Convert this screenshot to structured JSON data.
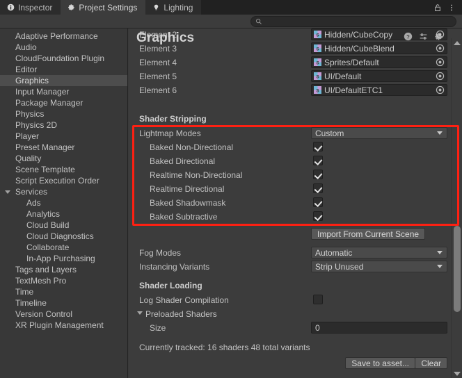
{
  "window": {
    "tabs": [
      {
        "label": "Inspector",
        "icon": "info-icon",
        "active": false
      },
      {
        "label": "Project Settings",
        "icon": "gear-icon",
        "active": true
      },
      {
        "label": "Lighting",
        "icon": "lightbulb-icon",
        "active": false
      }
    ],
    "lock_icon": "lock-icon",
    "menu_icon": "kebab-menu-icon"
  },
  "search": {
    "value": "",
    "placeholder": "",
    "icon": "search-icon"
  },
  "sidebar": {
    "items": [
      {
        "label": "Adaptive Performance",
        "depth": 0,
        "selected": false,
        "triangle": "none"
      },
      {
        "label": "Audio",
        "depth": 0,
        "selected": false,
        "triangle": "none"
      },
      {
        "label": "CloudFoundation Plugin",
        "depth": 0,
        "selected": false,
        "triangle": "none"
      },
      {
        "label": "Editor",
        "depth": 0,
        "selected": false,
        "triangle": "none"
      },
      {
        "label": "Graphics",
        "depth": 0,
        "selected": true,
        "triangle": "none"
      },
      {
        "label": "Input Manager",
        "depth": 0,
        "selected": false,
        "triangle": "none"
      },
      {
        "label": "Package Manager",
        "depth": 0,
        "selected": false,
        "triangle": "none"
      },
      {
        "label": "Physics",
        "depth": 0,
        "selected": false,
        "triangle": "none"
      },
      {
        "label": "Physics 2D",
        "depth": 0,
        "selected": false,
        "triangle": "none"
      },
      {
        "label": "Player",
        "depth": 0,
        "selected": false,
        "triangle": "none"
      },
      {
        "label": "Preset Manager",
        "depth": 0,
        "selected": false,
        "triangle": "none"
      },
      {
        "label": "Quality",
        "depth": 0,
        "selected": false,
        "triangle": "none"
      },
      {
        "label": "Scene Template",
        "depth": 0,
        "selected": false,
        "triangle": "none"
      },
      {
        "label": "Script Execution Order",
        "depth": 0,
        "selected": false,
        "triangle": "none"
      },
      {
        "label": "Services",
        "depth": 0,
        "selected": false,
        "triangle": "open"
      },
      {
        "label": "Ads",
        "depth": 1,
        "selected": false,
        "triangle": "none"
      },
      {
        "label": "Analytics",
        "depth": 1,
        "selected": false,
        "triangle": "none"
      },
      {
        "label": "Cloud Build",
        "depth": 1,
        "selected": false,
        "triangle": "none"
      },
      {
        "label": "Cloud Diagnostics",
        "depth": 1,
        "selected": false,
        "triangle": "none"
      },
      {
        "label": "Collaborate",
        "depth": 1,
        "selected": false,
        "triangle": "none"
      },
      {
        "label": "In-App Purchasing",
        "depth": 1,
        "selected": false,
        "triangle": "none"
      },
      {
        "label": "Tags and Layers",
        "depth": 0,
        "selected": false,
        "triangle": "none"
      },
      {
        "label": "TextMesh Pro",
        "depth": 0,
        "selected": false,
        "triangle": "none"
      },
      {
        "label": "Time",
        "depth": 0,
        "selected": false,
        "triangle": "none"
      },
      {
        "label": "Timeline",
        "depth": 0,
        "selected": false,
        "triangle": "none"
      },
      {
        "label": "Version Control",
        "depth": 0,
        "selected": false,
        "triangle": "none"
      },
      {
        "label": "XR Plugin Management",
        "depth": 0,
        "selected": false,
        "triangle": "none"
      }
    ]
  },
  "main": {
    "title": "Graphics",
    "title_icons": [
      "help-icon",
      "preset-icon",
      "gear-icon"
    ],
    "always_included_shaders": [
      {
        "label": "Element 2",
        "value": "Hidden/CubeCopy"
      },
      {
        "label": "Element 3",
        "value": "Hidden/CubeBlend"
      },
      {
        "label": "Element 4",
        "value": "Sprites/Default"
      },
      {
        "label": "Element 5",
        "value": "UI/Default"
      },
      {
        "label": "Element 6",
        "value": "UI/DefaultETC1"
      }
    ],
    "shader_stripping": {
      "heading": "Shader Stripping",
      "lightmap_modes": {
        "label": "Lightmap Modes",
        "value": "Custom"
      },
      "modes": [
        {
          "label": "Baked Non-Directional",
          "checked": true
        },
        {
          "label": "Baked Directional",
          "checked": true
        },
        {
          "label": "Realtime Non-Directional",
          "checked": true
        },
        {
          "label": "Realtime Directional",
          "checked": true
        },
        {
          "label": "Baked Shadowmask",
          "checked": true
        },
        {
          "label": "Baked Subtractive",
          "checked": true
        }
      ],
      "import_button": "Import From Current Scene",
      "fog_modes": {
        "label": "Fog Modes",
        "value": "Automatic"
      },
      "instancing_variants": {
        "label": "Instancing Variants",
        "value": "Strip Unused"
      }
    },
    "shader_loading": {
      "heading": "Shader Loading",
      "log_shader_compilation": {
        "label": "Log Shader Compilation",
        "checked": false
      },
      "preloaded_shaders": {
        "label": "Preloaded Shaders"
      },
      "size": {
        "label": "Size",
        "value": "0"
      },
      "tracked_text": "Currently tracked: 16 shaders 48 total variants",
      "save_button": "Save to asset...",
      "clear_button": "Clear"
    }
  },
  "colors": {
    "highlight": "#fe2012",
    "panel_bg": "#3c3c3c",
    "sidebar_bg": "#383838",
    "selected_row": "#4d4d4d"
  }
}
